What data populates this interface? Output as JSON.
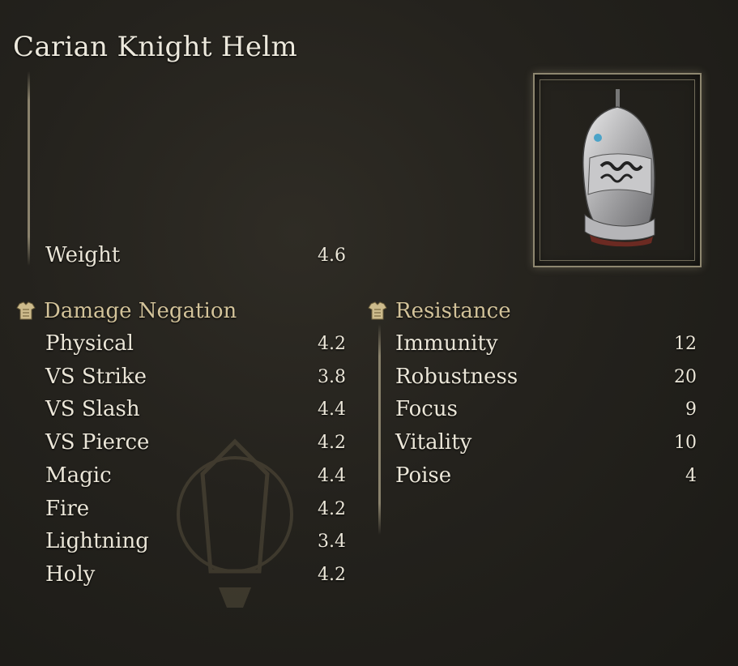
{
  "item": {
    "name": "Carian Knight Helm",
    "icon": "helm-icon"
  },
  "weight": {
    "label": "Weight",
    "value": "4.6"
  },
  "damage_negation": {
    "heading": "Damage Negation",
    "icon": "armor-icon",
    "rows": [
      {
        "label": "Physical",
        "value": "4.2"
      },
      {
        "label": "VS Strike",
        "value": "3.8"
      },
      {
        "label": "VS Slash",
        "value": "4.4"
      },
      {
        "label": "VS Pierce",
        "value": "4.2"
      },
      {
        "label": "Magic",
        "value": "4.4"
      },
      {
        "label": "Fire",
        "value": "4.2"
      },
      {
        "label": "Lightning",
        "value": "3.4"
      },
      {
        "label": "Holy",
        "value": "4.2"
      }
    ]
  },
  "resistance": {
    "heading": "Resistance",
    "icon": "armor-icon",
    "rows": [
      {
        "label": "Immunity",
        "value": "12"
      },
      {
        "label": "Robustness",
        "value": "20"
      },
      {
        "label": "Focus",
        "value": "9"
      },
      {
        "label": "Vitality",
        "value": "10"
      },
      {
        "label": "Poise",
        "value": "4"
      }
    ]
  },
  "colors": {
    "background": "#24221d",
    "text": "#ebe6d8",
    "heading": "#d3c39a"
  }
}
